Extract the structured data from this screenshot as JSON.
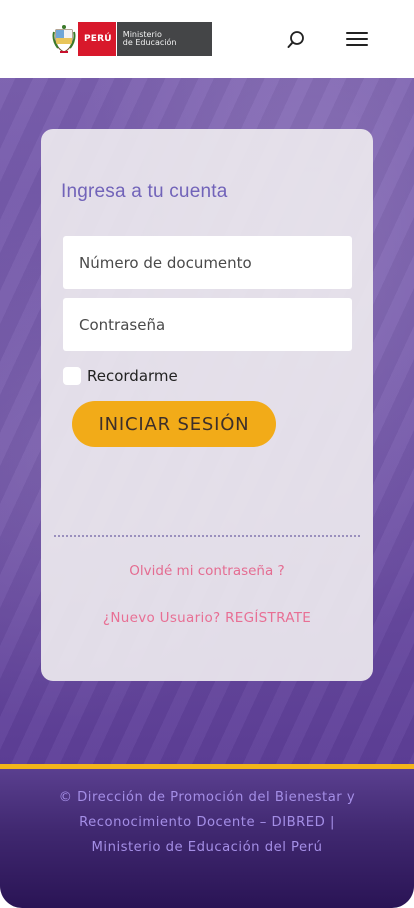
{
  "header": {
    "logo": {
      "country": "PERÚ",
      "ministry_line1": "Ministerio",
      "ministry_line2": "de Educación"
    },
    "icons": {
      "search": "search-icon",
      "menu": "hamburger-menu-icon"
    }
  },
  "login": {
    "title": "Ingresa a tu cuenta",
    "document_placeholder": "Número de documento",
    "password_placeholder": "Contraseña",
    "remember_label": "Recordarme",
    "submit_label": "INICIAR SESIÓN",
    "forgot_password": "Olvidé mi contraseña ?",
    "new_user_text": "¿Nuevo Usuario?",
    "register_link": "REGÍSTRATE"
  },
  "footer": {
    "line1": "© Dirección de Promoción del Bienestar y",
    "line2": "Reconocimiento Docente – DIBRED  |",
    "line3": "Ministerio de Educación del Perú"
  },
  "colors": {
    "accent_gold": "#f2ab18",
    "title_purple": "#7163b9",
    "link_pink": "#e46c91",
    "hero_purple": "#7054a7",
    "footer_purple": "#2a1455"
  }
}
